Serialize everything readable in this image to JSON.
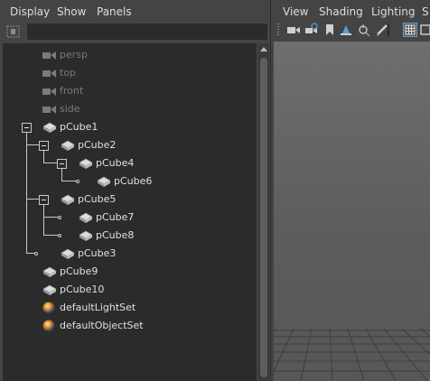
{
  "outliner": {
    "menu": [
      "Display",
      "Show",
      "Panels"
    ],
    "search": {
      "value": ""
    },
    "nodes": [
      {
        "label": "persp",
        "icon": "camera-icon",
        "dim": true
      },
      {
        "label": "top",
        "icon": "camera-icon",
        "dim": true
      },
      {
        "label": "front",
        "icon": "camera-icon",
        "dim": true
      },
      {
        "label": "side",
        "icon": "camera-icon",
        "dim": true
      },
      {
        "label": "pCube1",
        "icon": "mesh-icon",
        "dim": false
      },
      {
        "label": "pCube2",
        "icon": "mesh-icon",
        "dim": false
      },
      {
        "label": "pCube4",
        "icon": "mesh-icon",
        "dim": false
      },
      {
        "label": "pCube6",
        "icon": "mesh-icon",
        "dim": false
      },
      {
        "label": "pCube5",
        "icon": "mesh-icon",
        "dim": false
      },
      {
        "label": "pCube7",
        "icon": "mesh-icon",
        "dim": false
      },
      {
        "label": "pCube8",
        "icon": "mesh-icon",
        "dim": false
      },
      {
        "label": "pCube3",
        "icon": "mesh-icon",
        "dim": false
      },
      {
        "label": "pCube9",
        "icon": "mesh-icon",
        "dim": false
      },
      {
        "label": "pCube10",
        "icon": "mesh-icon",
        "dim": false
      },
      {
        "label": "defaultLightSet",
        "icon": "set-icon",
        "dim": false
      },
      {
        "label": "defaultObjectSet",
        "icon": "set-icon",
        "dim": false
      }
    ]
  },
  "viewport": {
    "menu": [
      "View",
      "Shading",
      "Lighting",
      "S"
    ],
    "toolbar_icons": [
      "camera-icon",
      "camera-attributes-icon",
      "bookmark-icon",
      "image-plane-icon",
      "two-d-pan-zoom-icon",
      "grease-pencil-icon",
      "grid-toggle-icon",
      "film-gate-icon"
    ]
  },
  "colors": {
    "panel": "#444444",
    "tree_bg": "#2b2b2b",
    "text": "#e0e0e0",
    "dim_text": "#7a7a7a",
    "highlight": "#5aa0d8"
  }
}
